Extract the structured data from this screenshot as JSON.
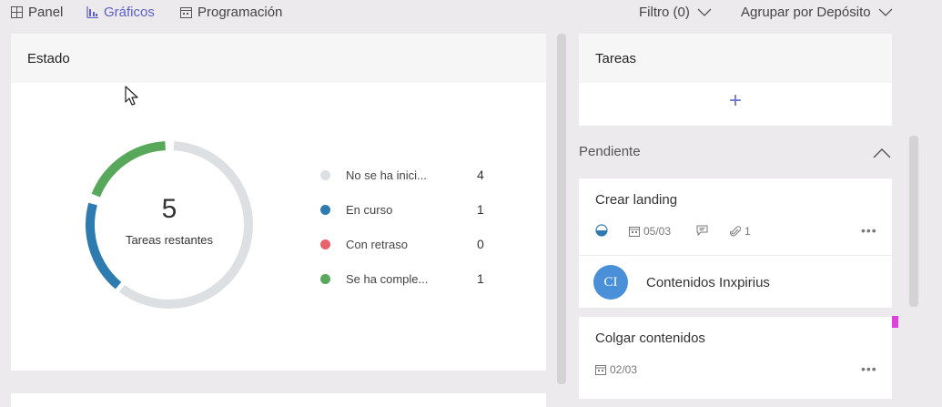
{
  "nav": {
    "panel": "Panel",
    "graficos": "Gráficos",
    "programacion": "Programación",
    "filter": "Filtro (0)",
    "group": "Agrupar por Depósito"
  },
  "status": {
    "title": "Estado",
    "center_value": "5",
    "center_label": "Tareas restantes",
    "legend": [
      {
        "label": "No se ha inici...",
        "count": "4",
        "color": "#dde0e3"
      },
      {
        "label": "En curso",
        "count": "1",
        "color": "#2e7bb0"
      },
      {
        "label": "Con retraso",
        "count": "0",
        "color": "#e8626c"
      },
      {
        "label": "Se ha comple...",
        "count": "1",
        "color": "#57a85a"
      }
    ]
  },
  "tasks": {
    "title": "Tareas",
    "add_symbol": "+",
    "bucket": "Pendiente",
    "cards": [
      {
        "title": "Crear landing",
        "date": "05/03",
        "attachments": "1",
        "assignee_initials": "CI",
        "assignee_name": "Contenidos Inxpirius"
      },
      {
        "title": "Colgar contenidos",
        "date": "02/03"
      }
    ]
  },
  "colors": {
    "accent": "#5b5fc7",
    "background": "#eceaec",
    "not_started": "#dde0e3",
    "in_progress": "#2e7bb0",
    "late": "#e8626c",
    "completed": "#57a85a",
    "avatar": "#4a90d9",
    "label_magenta": "#e040e0"
  }
}
